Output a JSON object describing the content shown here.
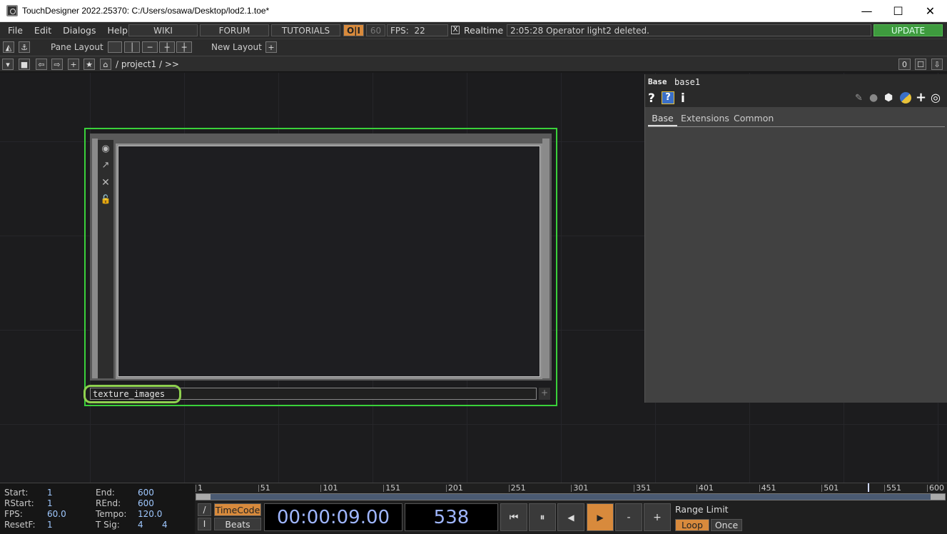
{
  "window": {
    "title": "TouchDesigner 2022.25370: C:/Users/osawa/Desktop/lod2.1.toe*",
    "minimize": "—",
    "maximize": "☐",
    "close": "✕"
  },
  "menu": {
    "items": [
      "File",
      "Edit",
      "Dialogs",
      "Help"
    ]
  },
  "top": {
    "wiki": "WIKI",
    "forum": "FORUM",
    "tutorials": "TUTORIALS",
    "oi": "O|I",
    "fps_cap": "60",
    "fps_label": "FPS:",
    "fps_value": "22",
    "realtime_check": "X",
    "realtime_label": "Realtime",
    "status": "2:05:28 Operator light2 deleted.",
    "update": "UPDATE"
  },
  "toolbar": {
    "pane_layout": "Pane Layout",
    "new_layout": "New Layout",
    "add": "+"
  },
  "path": {
    "text": "/ project1 / >>",
    "counter": "0"
  },
  "node": {
    "name": "texture_images",
    "colors": {
      "selected": "#3ad13a",
      "highlight": "#8fd14f"
    }
  },
  "params": {
    "type": "Base",
    "name": "base1",
    "help": "?",
    "info": "i",
    "tabs": [
      "Base",
      "Extensions",
      "Common"
    ]
  },
  "stats": {
    "left": [
      {
        "label": "Start:",
        "value": "1"
      },
      {
        "label": "RStart:",
        "value": "1"
      },
      {
        "label": "FPS:",
        "value": "60.0"
      },
      {
        "label": "ResetF:",
        "value": "1"
      }
    ],
    "right": [
      {
        "label": "End:",
        "value": "600"
      },
      {
        "label": "REnd:",
        "value": "600"
      },
      {
        "label": "Tempo:",
        "value": "120.0"
      },
      {
        "label": "T Sig:",
        "value": "4",
        "value2": "4"
      }
    ]
  },
  "timeline": {
    "ticks": [
      "1",
      "51",
      "101",
      "151",
      "201",
      "251",
      "301",
      "351",
      "401",
      "451",
      "501",
      "551",
      "600"
    ],
    "current_frame": 538,
    "timecode_btn": "TimeCode",
    "beats_btn": "Beats",
    "timecode": "00:00:09.00",
    "frame": "538",
    "range_limit": "Range Limit",
    "loop": "Loop",
    "once": "Once",
    "minus": "-",
    "plus": "+"
  }
}
